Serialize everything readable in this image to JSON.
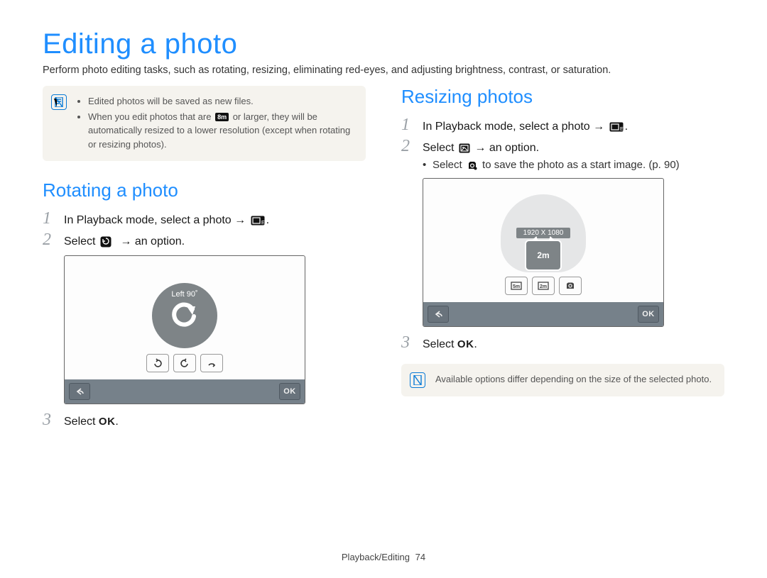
{
  "page": {
    "title": "Editing a photo",
    "intro": "Perform photo editing tasks, such as rotating, resizing, eliminating red-eyes, and adjusting brightness, contrast, or saturation."
  },
  "notes_top": {
    "item1": "Edited photos will be saved as new files.",
    "item2a": "When you edit photos that are ",
    "item2b": " or larger, they will be automatically resized to a lower resolution (except when rotating or resizing photos).",
    "size_badge": "8m"
  },
  "rotating": {
    "heading": "Rotating a photo",
    "step1a": "In Playback mode, select a photo → ",
    "step1b": ".",
    "step2a": "Select ",
    "step2b": " → an option.",
    "step3a": "Select ",
    "step3_ok": "OK",
    "step3b": ".",
    "shot": {
      "label": "Left 90˚",
      "back": "↶",
      "ok": "OK"
    }
  },
  "resizing": {
    "heading": "Resizing photos",
    "step1a": "In Playback mode, select a photo → ",
    "step1b": ".",
    "step2a": "Select ",
    "step2b": " → an option.",
    "sub1a": "Select ",
    "sub1b": " to save the photo as a start image. (p. 90)",
    "step3a": "Select ",
    "step3_ok": "OK",
    "step3b": ".",
    "shot": {
      "dim": "1920 X 1080",
      "center_badge": "2m",
      "back": "↶",
      "ok": "OK"
    },
    "note": "Available options differ depending on the size of the selected photo."
  },
  "footer": {
    "section": "Playback/Editing",
    "page": "74"
  }
}
